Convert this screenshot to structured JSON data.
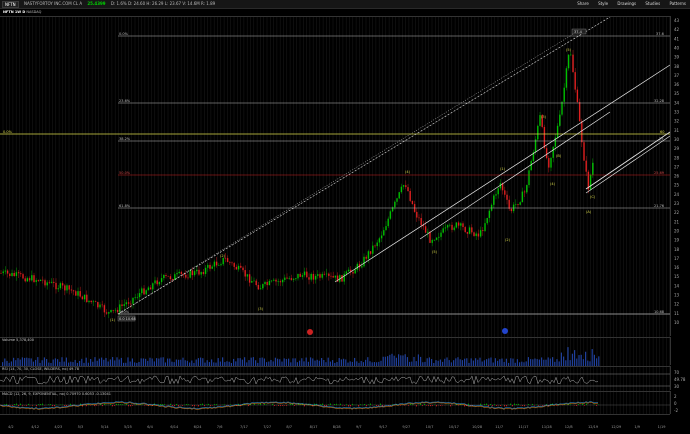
{
  "toolbar": {
    "symbol": "NFTN",
    "description": "NASTYFORTOY INC.COM CL A",
    "last": "25.4399",
    "quote_line": "D: 1.6% D: 24.60 H: 26.29 L: 23.67 V: 14.6M R: 1.89",
    "share": "Share",
    "style": "Style",
    "drawings": "Drawings",
    "studies": "Studies",
    "patterns": "Patterns"
  },
  "study_line": {
    "symbol": "NFTN 1W D",
    "exchange": "NASDAQ"
  },
  "fib_labels": [
    {
      "left": "0.0%",
      "right": "37.6"
    },
    {
      "left": "23.6%",
      "right": "32.28"
    },
    {
      "left": "38.2%",
      "right": "29"
    },
    {
      "left": "50.0%",
      "right": "25.69"
    },
    {
      "left": "61.8%",
      "right": "21.76"
    },
    {
      "left": "100%",
      "right": "10.68"
    }
  ],
  "price_labels": [
    "43",
    "42",
    "41",
    "40",
    "39",
    "38",
    "37",
    "36",
    "35",
    "34",
    "33",
    "32",
    "31",
    "30",
    "29",
    "28",
    "27",
    "26",
    "25",
    "24",
    "23",
    "22",
    "21",
    "20",
    "19",
    "18",
    "17",
    "16",
    "15",
    "14",
    "13",
    "12",
    "11",
    "10"
  ],
  "annotations": {
    "low_price": "0.0 10.68",
    "high_price": "37.4",
    "yellow_line_left": "0.0%",
    "yellow_line_right": "60"
  },
  "wave_labels": [
    "(1)",
    "(2)",
    "(3)",
    "(4)",
    "(5)",
    "(1)",
    "(2)",
    "(3)",
    "(4)",
    "(5)",
    "(A)",
    "(B)",
    "(C)"
  ],
  "volume": {
    "title": "Volume",
    "value": "5,378,400"
  },
  "rsi": {
    "title": "RSI (14, 70, 30, CLOSE, WILDERS, no) 49.78",
    "values": [
      "70",
      "49.78",
      "30"
    ]
  },
  "macd": {
    "title": "MACD (12, 26, 9, EXPONENTIAL, no) 0.70970 0.6053 -0.13041",
    "values": [
      "2",
      "0",
      "-2"
    ]
  },
  "x_dates": [
    "4/2",
    "4/12",
    "4/23",
    "5/3",
    "5/14",
    "5/25",
    "6/4",
    "6/14",
    "6/24",
    "7/6",
    "7/17",
    "7/27",
    "8/7",
    "8/17",
    "8/28",
    "9/7",
    "9/17",
    "9/27",
    "10/7",
    "10/17",
    "10/28",
    "11/7",
    "11/17",
    "11/28",
    "12/8",
    "12/19",
    "12/29",
    "1/9",
    "1/19"
  ],
  "colors": {
    "up": "#00c000",
    "down": "#e02020",
    "fib": "#bbbbbb",
    "yellow": "#d8d84a",
    "channel": "#e6e6e6"
  }
}
